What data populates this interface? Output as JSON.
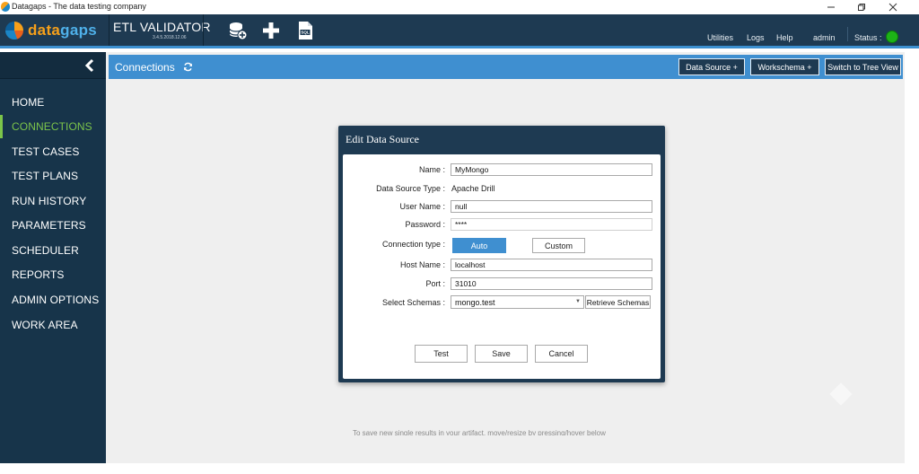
{
  "window": {
    "title": "Datagaps - The data testing company"
  },
  "appbar": {
    "logo_part1": "data",
    "logo_part2": "gaps",
    "product_name": "ETL VALIDATOR",
    "product_version": "3.4.5.2018.12.06",
    "toolbar_icons": [
      "add-datasource-icon",
      "plus-icon",
      "sql-icon"
    ],
    "nav": {
      "utilities": "Utilities",
      "logs": "Logs",
      "help": "Help",
      "user": "admin",
      "status_label": "Status :"
    },
    "status_color": "#1db317"
  },
  "sidebar": {
    "items": [
      {
        "label": "HOME",
        "active": false
      },
      {
        "label": "CONNECTIONS",
        "active": true
      },
      {
        "label": "TEST CASES",
        "active": false
      },
      {
        "label": "TEST PLANS",
        "active": false
      },
      {
        "label": "RUN HISTORY",
        "active": false
      },
      {
        "label": "PARAMETERS",
        "active": false
      },
      {
        "label": "SCHEDULER",
        "active": false
      },
      {
        "label": "REPORTS",
        "active": false
      },
      {
        "label": "ADMIN OPTIONS",
        "active": false
      },
      {
        "label": "WORK AREA",
        "active": false
      }
    ],
    "active_color": "#7cc54a"
  },
  "content": {
    "title": "Connections",
    "buttons": {
      "data_source": "Data Source +",
      "workschema": "Workschema +",
      "tree_view": "Switch to Tree View"
    },
    "background_text": "To save new single results in your artifact, move/resize by pressing/hover below"
  },
  "dialog": {
    "title": "Edit Data Source",
    "fields": {
      "name_label": "Name :",
      "name_value": "MyMongo",
      "type_label": "Data Source Type :",
      "type_value": "Apache Drill",
      "user_label": "User Name :",
      "user_value": "null",
      "password_label": "Password :",
      "password_value": "****",
      "conn_label": "Connection type :",
      "conn_auto": "Auto",
      "conn_custom": "Custom",
      "host_label": "Host Name :",
      "host_value": "localhost",
      "port_label": "Port :",
      "port_value": "31010",
      "schema_label": "Select Schemas :",
      "schema_value": "mongo.test",
      "retrieve_label": "Retrieve Schemas"
    },
    "buttons": {
      "test": "Test",
      "save": "Save",
      "cancel": "Cancel"
    },
    "accent_color": "#3f8fd0"
  }
}
